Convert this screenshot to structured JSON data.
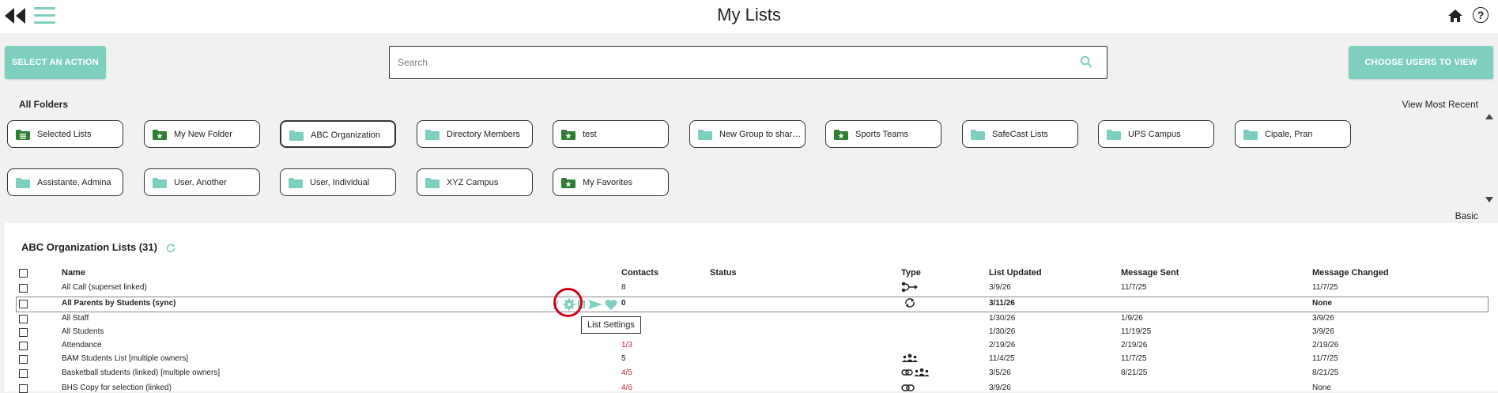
{
  "header": {
    "title": "My Lists"
  },
  "actions": {
    "select_action": "SELECT AN ACTION",
    "choose_users": "CHOOSE USERS TO VIEW"
  },
  "search": {
    "placeholder": "Search"
  },
  "folders": {
    "label": "All Folders",
    "view_most_recent": "View Most Recent",
    "basic": "Basic",
    "items": [
      {
        "label": "Selected Lists",
        "icon": "folder-list-icon",
        "color": "#2e7d32"
      },
      {
        "label": "My New Folder",
        "icon": "folder-star-icon",
        "color": "#2e7d32"
      },
      {
        "label": "ABC Organization",
        "icon": "folder-icon",
        "color": "#7fcfbf"
      },
      {
        "label": "Directory Members",
        "icon": "folder-icon",
        "color": "#7fcfbf"
      },
      {
        "label": "test",
        "icon": "folder-star-icon",
        "color": "#2e7d32"
      },
      {
        "label": "New Group to share...",
        "icon": "folder-icon",
        "color": "#7fcfbf"
      },
      {
        "label": "Sports Teams",
        "icon": "folder-star-icon",
        "color": "#2e7d32"
      },
      {
        "label": "SafeCast Lists",
        "icon": "folder-icon",
        "color": "#7fcfbf"
      },
      {
        "label": "UPS Campus",
        "icon": "folder-icon",
        "color": "#7fcfbf"
      },
      {
        "label": "Cipale, Pran",
        "icon": "folder-icon",
        "color": "#7fcfbf"
      },
      {
        "label": "Assistante, Admina",
        "icon": "folder-icon",
        "color": "#7fcfbf"
      },
      {
        "label": "User, Another",
        "icon": "folder-icon",
        "color": "#7fcfbf"
      },
      {
        "label": "User, Individual",
        "icon": "folder-icon",
        "color": "#7fcfbf"
      },
      {
        "label": "XYZ Campus",
        "icon": "folder-icon",
        "color": "#7fcfbf"
      },
      {
        "label": "My Favorites",
        "icon": "folder-star-icon",
        "color": "#2e7d32"
      }
    ]
  },
  "lists": {
    "title": "ABC Organization Lists (31)",
    "columns": {
      "name": "Name",
      "contacts": "Contacts",
      "status": "Status",
      "type": "Type",
      "updated": "List Updated",
      "sent": "Message Sent",
      "changed": "Message Changed"
    },
    "tooltip": "List Settings",
    "rows": [
      {
        "name": "All Call (superset linked)",
        "contacts": "8",
        "type_icon": "superset-icon",
        "updated": "3/9/26",
        "sent": "11/7/25",
        "changed": "11/7/25"
      },
      {
        "name": "All Parents by Students (sync)",
        "contacts": "0",
        "type_icon": "sync-icon",
        "updated": "3/11/26",
        "sent": "",
        "changed": "None"
      },
      {
        "name": "All Staff",
        "contacts": "",
        "type_icon": "",
        "updated": "1/30/26",
        "sent": "1/9/26",
        "changed": "3/9/26"
      },
      {
        "name": "All Students",
        "contacts": "",
        "type_icon": "",
        "updated": "1/30/26",
        "sent": "11/19/25",
        "changed": "3/9/26"
      },
      {
        "name": "Attendance",
        "contacts": "1/3",
        "type_icon": "",
        "updated": "2/19/26",
        "sent": "2/19/26",
        "changed": "2/19/26"
      },
      {
        "name": "BAM Students List [multiple owners]",
        "contacts": "5",
        "type_icon": "group-icon",
        "updated": "11/4/25",
        "sent": "11/7/25",
        "changed": "11/7/25"
      },
      {
        "name": "Basketball students (linked) [multiple owners]",
        "contacts": "4/5",
        "type_icon": "link-group-icon",
        "updated": "3/5/26",
        "sent": "8/21/25",
        "changed": "8/21/25"
      },
      {
        "name": "BHS Copy for selection (linked)",
        "contacts": "4/6",
        "type_icon": "link-icon",
        "updated": "3/9/26",
        "sent": "",
        "changed": "None"
      }
    ]
  }
}
